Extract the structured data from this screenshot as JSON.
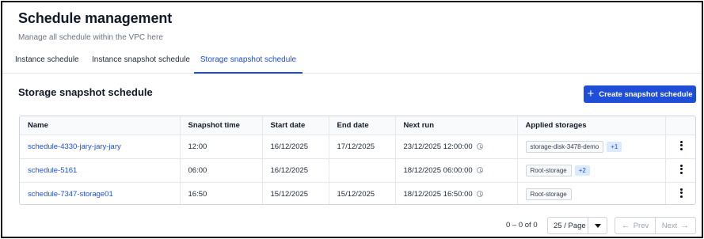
{
  "header": {
    "title": "Schedule management",
    "subtitle": "Manage all schedule within the VPC here"
  },
  "tabs": [
    {
      "label": "Instance schedule",
      "active": false
    },
    {
      "label": "Instance snapshot schedule",
      "active": false
    },
    {
      "label": "Storage snapshot schedule",
      "active": true
    }
  ],
  "section": {
    "title": "Storage snapshot schedule",
    "create_button": "Create snapshot schedule"
  },
  "table": {
    "columns": [
      "Name",
      "Snapshot time",
      "Start date",
      "End date",
      "Next run",
      "Applied storages",
      ""
    ],
    "rows": [
      {
        "name": "schedule-4330-jary-jary-jary",
        "snapshot_time": "12:00",
        "start_date": "16/12/2025",
        "end_date": "17/12/2025",
        "next_run": "23/12/2025 12:00:00",
        "storage": "storage-disk-3478-demo",
        "more": "+1"
      },
      {
        "name": "schedule-5161",
        "snapshot_time": "06:00",
        "start_date": "16/12/2025",
        "end_date": "",
        "next_run": "18/12/2025 06:00:00",
        "storage": "Root-storage",
        "more": "+2"
      },
      {
        "name": "schedule-7347-storage01",
        "snapshot_time": "16:50",
        "start_date": "15/12/2025",
        "end_date": "15/12/2025",
        "next_run": "18/12/2025 16:50:00",
        "storage": "Root-storage",
        "more": ""
      }
    ]
  },
  "pagination": {
    "range": "0 – 0 of 0",
    "page_size": "25 / Page",
    "prev": "Prev",
    "next": "Next"
  },
  "colors": {
    "accent": "#1e4ed8",
    "link": "#1d4ed8"
  }
}
